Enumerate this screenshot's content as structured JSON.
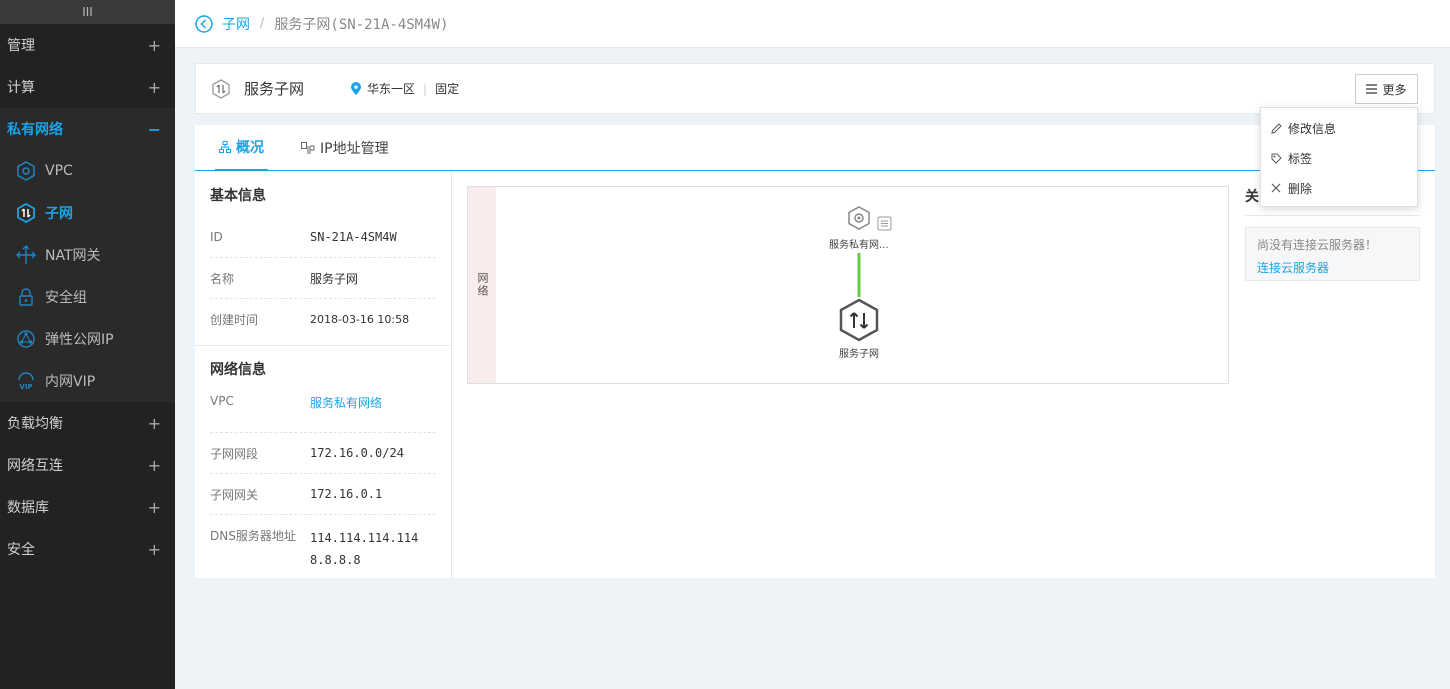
{
  "sidebar": {
    "top_icon": "III",
    "groups_top": [
      {
        "label": "管理",
        "toggle": "+"
      },
      {
        "label": "计算",
        "toggle": "+"
      }
    ],
    "active_group": {
      "label": "私有网络",
      "toggle": "−"
    },
    "items": [
      {
        "label": "VPC",
        "icon": "vpc-icon"
      },
      {
        "label": "子网",
        "icon": "subnet-icon"
      },
      {
        "label": "NAT网关",
        "icon": "nat-icon"
      },
      {
        "label": "安全组",
        "icon": "lock-icon"
      },
      {
        "label": "弹性公网IP",
        "icon": "eip-icon"
      },
      {
        "label": "内网VIP",
        "icon": "vip-icon"
      }
    ],
    "groups_bottom": [
      {
        "label": "负载均衡",
        "toggle": "+"
      },
      {
        "label": "网络互连",
        "toggle": "+"
      },
      {
        "label": "数据库",
        "toggle": "+"
      },
      {
        "label": "安全",
        "toggle": "+"
      }
    ]
  },
  "breadcrumb": {
    "parent": "子网",
    "separator": "/",
    "current": "服务子网(SN-21A-4SM4W)"
  },
  "header": {
    "title": "服务子网",
    "region": "华东一区",
    "separator": "|",
    "type": "固定",
    "more_label": "更多"
  },
  "more_menu": {
    "items": [
      {
        "label": "修改信息",
        "icon": "pencil-icon"
      },
      {
        "label": "标签",
        "icon": "tag-icon"
      },
      {
        "label": "删除",
        "icon": "close-icon"
      }
    ]
  },
  "tabs": [
    {
      "label": "概况",
      "active": true
    },
    {
      "label": "IP地址管理",
      "active": false
    }
  ],
  "basic_info": {
    "title": "基本信息",
    "rows": [
      {
        "key": "ID",
        "value": "SN-21A-4SM4W"
      },
      {
        "key": "名称",
        "value": "服务子网"
      },
      {
        "key": "创建时间",
        "value": "2018-03-16 10:58"
      }
    ]
  },
  "network_info": {
    "title": "网络信息",
    "vpc_key": "VPC",
    "vpc_value": "服务私有网络",
    "cidr_key": "子网网段",
    "cidr_value": "172.16.0.0/24",
    "gateway_key": "子网网关",
    "gateway_value": "172.16.0.1",
    "dns_key": "DNS服务器地址",
    "dns_values": [
      "114.114.114.114",
      "8.8.8.8"
    ]
  },
  "topology": {
    "band_label": "网络",
    "vpc_node_label": "服务私有网...",
    "subnet_node_label": "服务子网",
    "link_color": "#66cc44"
  },
  "related": {
    "title": "关",
    "empty_text": "尚没有连接云服务器！",
    "connect_link": "连接云服务器"
  },
  "colors": {
    "accent": "#1aa3e8",
    "sidebar_bg": "#222222"
  }
}
